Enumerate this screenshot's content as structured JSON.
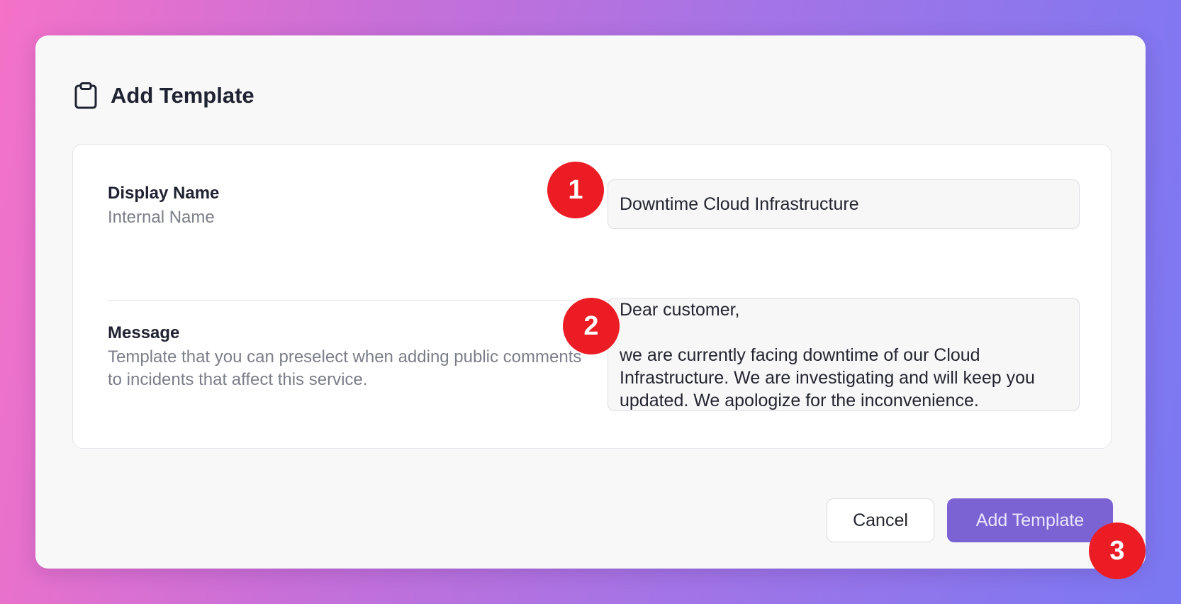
{
  "header": {
    "icon": "clipboard-icon",
    "title": "Add Template"
  },
  "form": {
    "display_name": {
      "label": "Display Name",
      "description": "Internal Name",
      "value": "Downtime Cloud Infrastructure"
    },
    "message": {
      "label": "Message",
      "description": "Template that you can preselect when adding public comments to incidents that affect this service.",
      "value": "Dear customer,\n\nwe are currently facing downtime of our Cloud Infrastructure. We are investigating and will keep you updated. We apologize for the inconvenience."
    }
  },
  "actions": {
    "cancel_label": "Cancel",
    "submit_label": "Add Template"
  },
  "annotations": {
    "step1": "1",
    "step2": "2",
    "step3": "3",
    "color": "#ec1c24"
  },
  "colors": {
    "primary_button": "#7b63d3",
    "background_gradient_start": "#f472c8",
    "background_gradient_end": "#7a78f2"
  }
}
